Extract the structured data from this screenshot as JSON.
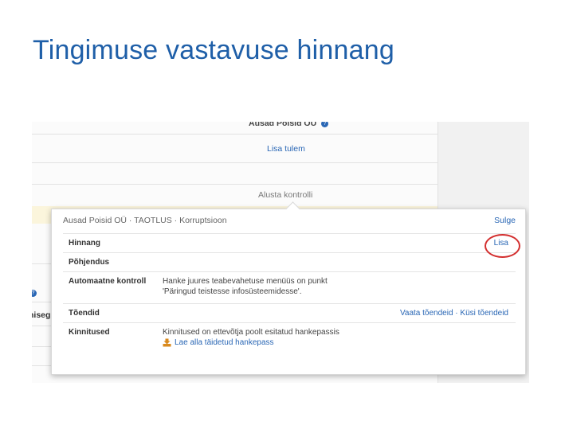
{
  "slide": {
    "title": "Tingimuse vastavuse hinnang"
  },
  "background": {
    "company": "Ausad Poisid OÜ",
    "add_result_link": "Lisa tulem",
    "start_check_link": "Alusta kontrolli",
    "cut_word": "niseg"
  },
  "popover": {
    "breadcrumb": "Ausad Poisid OÜ · TAOTLUS · Korruptsioon",
    "close_link": "Sulge",
    "rows": [
      {
        "label": "Hinnang",
        "link": "Lisa"
      },
      {
        "label": "Põhjendus"
      },
      {
        "label": "Automaatne kontroll",
        "value_line1": "Hanke juures teabevahetuse menüüs on punkt",
        "value_line2": "'Päringud teistesse infosüsteemidesse'."
      },
      {
        "label": "Tõendid",
        "link": "Vaata tõendeid · Küsi tõendeid"
      },
      {
        "label": "Kinnitused",
        "value_line1": "Kinnitused on ettevõtja poolt esitatud hankepassis",
        "download_link": "Lae alla täidetud hankepass"
      }
    ]
  },
  "colors": {
    "title": "#1f5fa8",
    "link": "#2a67b5",
    "highlight_oval": "#d32f2f",
    "download_icon": "#d98a1e"
  }
}
